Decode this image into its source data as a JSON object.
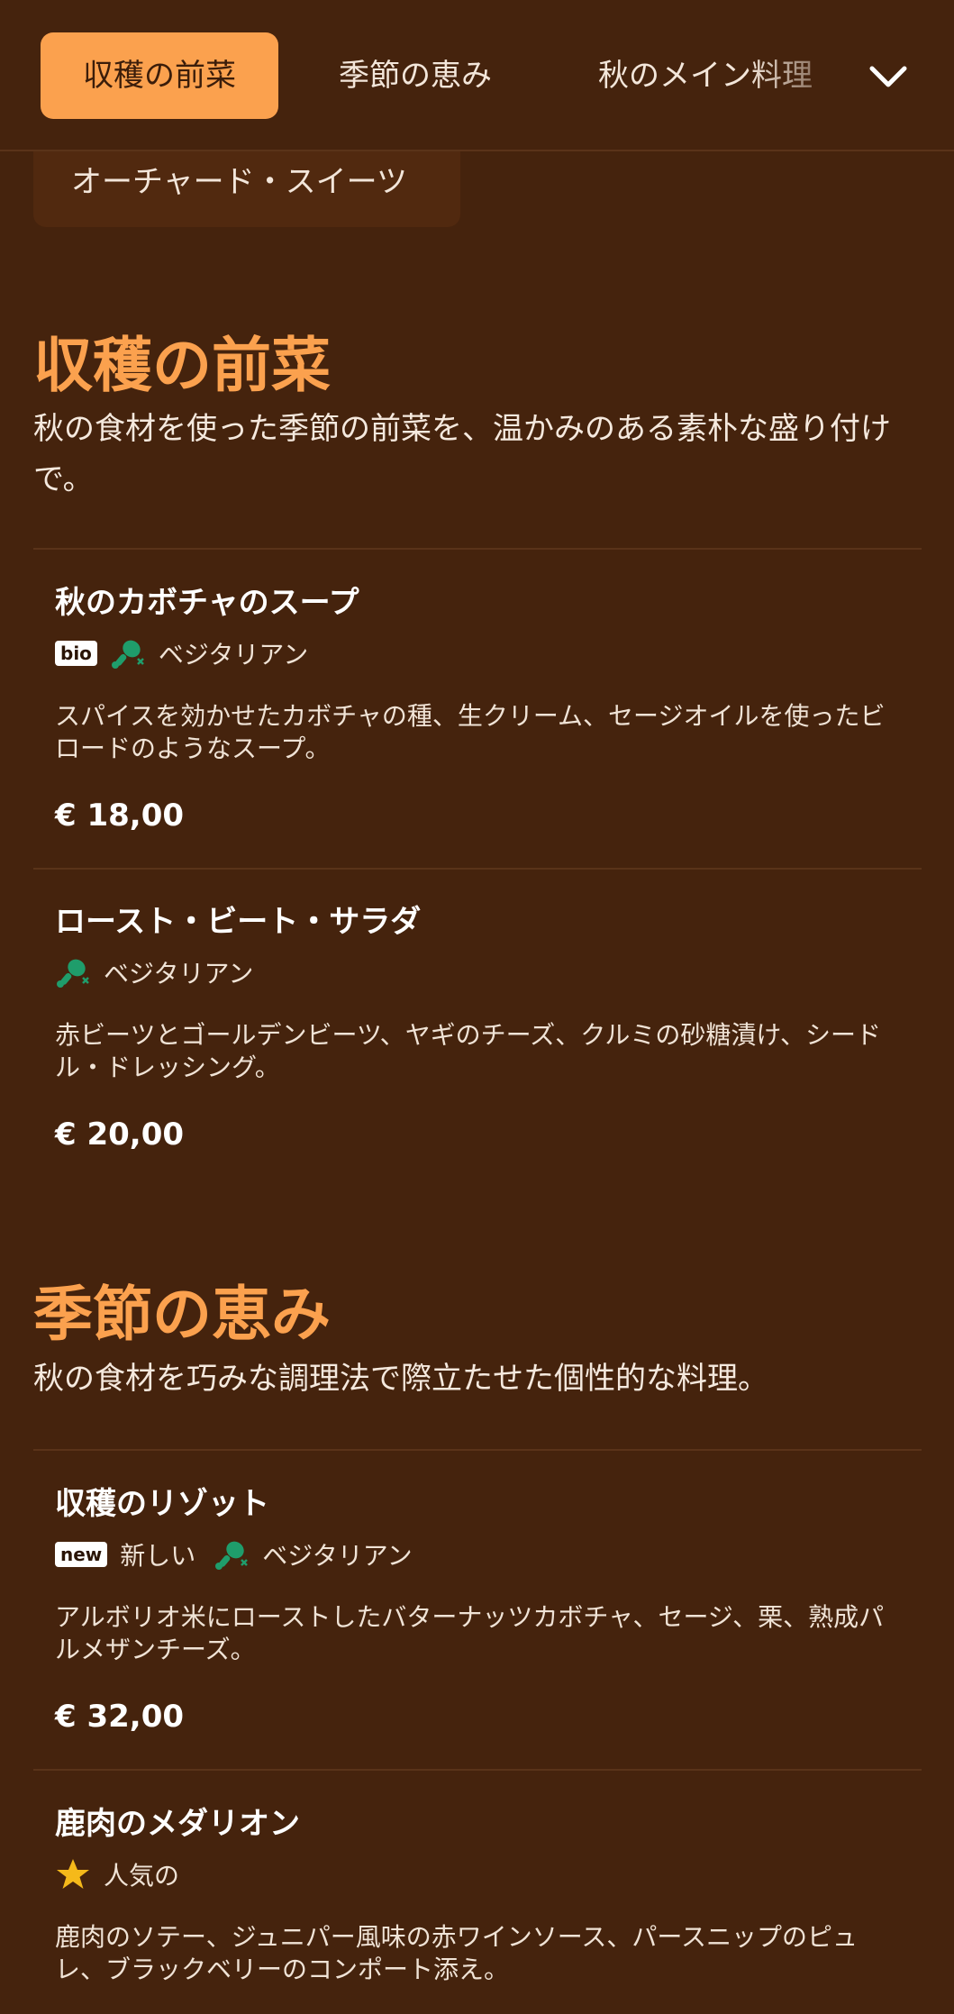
{
  "nav": {
    "tabs": [
      {
        "label": "収穫の前菜",
        "active": true
      },
      {
        "label": "季節の恵み",
        "active": false
      },
      {
        "label": "秋のメイン料理",
        "active": false
      },
      {
        "label": "オーチャード・スイーツ",
        "active": false
      }
    ],
    "expand_icon": "chevron-down-icon"
  },
  "colors": {
    "background": "#45230d",
    "accent": "#fba14e",
    "vegetarian_icon": "#1f9d6b",
    "star": "#f5b91a"
  },
  "sections": [
    {
      "title": "収穫の前菜",
      "description": "秋の食材を使った季節の前菜を、温かみのある素朴な盛り付けで。",
      "items": [
        {
          "name": "秋のカボチャのスープ",
          "badge": "bio",
          "tag": "ベジタリアン",
          "description": "スパイスを効かせたカボチャの種、生クリーム、セージオイルを使ったビロードのようなスープ。",
          "price": "€ 18,00"
        },
        {
          "name": "ロースト・ビート・サラダ",
          "tag": "ベジタリアン",
          "description": "赤ビーツとゴールデンビーツ、ヤギのチーズ、クルミの砂糖漬け、シードル・ドレッシング。",
          "price": "€ 20,00"
        }
      ]
    },
    {
      "title": "季節の恵み",
      "description": "秋の食材を巧みな調理法で際立たせた個性的な料理。",
      "items": [
        {
          "name": "収穫のリゾット",
          "badge": "new",
          "badge_label": "新しい",
          "tag": "ベジタリアン",
          "description": "アルボリオ米にローストしたバターナッツカボチャ、セージ、栗、熟成パルメザンチーズ。",
          "price": "€ 32,00"
        },
        {
          "name": "鹿肉のメダリオン",
          "tag": "人気の",
          "description": "鹿肉のソテー、ジュニパー風味の赤ワインソース、パースニップのピュレ、ブラックベリーのコンポート添え。"
        }
      ]
    }
  ]
}
